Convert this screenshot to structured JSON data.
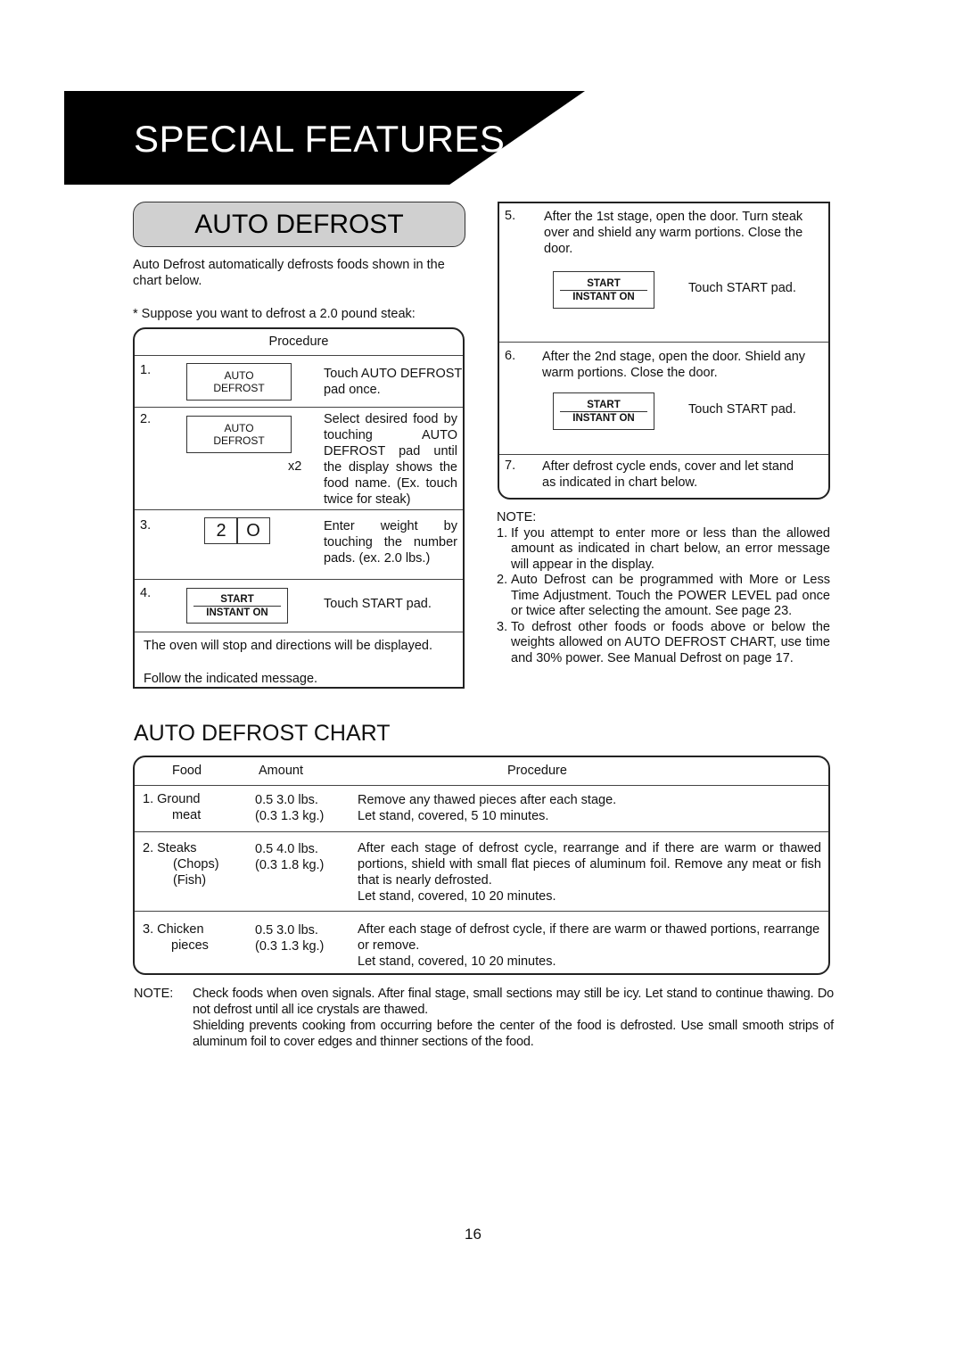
{
  "banner": {
    "title": "SPECIAL FEATURES"
  },
  "section": {
    "title": "AUTO DEFROST",
    "intro": "Auto Defrost automatically defrosts foods shown in the chart below.",
    "suppose": "*  Suppose you  want to defrost a 2.0 pound steak:"
  },
  "procedure": {
    "header": "Procedure",
    "steps": [
      {
        "num": "1.",
        "pad": [
          "AUTO",
          "DEFROST"
        ],
        "text": "Touch AUTO DEFROST pad once."
      },
      {
        "num": "2.",
        "pad": [
          "AUTO",
          "DEFROST"
        ],
        "multiplier": "x2",
        "text": "Select desired food by touching AUTO DEFROST pad until the display shows the food name. (Ex. touch twice for steak)"
      },
      {
        "num": "3.",
        "keys": [
          "2",
          "O"
        ],
        "text": "Enter weight by touching the number pads. (ex. 2.0 lbs.)"
      },
      {
        "num": "4.",
        "pad": [
          "START",
          "INSTANT ON"
        ],
        "text": "Touch START pad."
      }
    ],
    "footer": "The oven will stop and directions will be displayed.",
    "footer2": "Follow the indicated message.",
    "steps_right": [
      {
        "num": "5.",
        "text": "After the 1st stage, open the door. Turn steak over and shield any warm portions. Close the door.",
        "pad": [
          "START",
          "INSTANT ON"
        ],
        "action": "Touch START pad."
      },
      {
        "num": "6.",
        "text": "After the 2nd stage, open the door. Shield any warm portions. Close the door.",
        "pad": [
          "START",
          "INSTANT ON"
        ],
        "action": "Touch START pad."
      },
      {
        "num": "7.",
        "text": "After defrost cycle ends, cover and let stand as indicated in chart below."
      }
    ]
  },
  "notes": {
    "title": "NOTE:",
    "items": [
      {
        "num": "1.",
        "text": "If you attempt to enter more or less than the allowed amount as indicated in chart below, an  error message  will appear in the display."
      },
      {
        "num": "2.",
        "text": "Auto Defrost can be programmed with More or Less Time Adjustment. Touch the POWER LEVEL pad once or twice after selecting the amount. See page 23."
      },
      {
        "num": "3.",
        "text": "To defrost other foods or foods above or below the weights allowed on AUTO DEFROST CHART, use time and 30% power. See Manual Defrost on page 17."
      }
    ]
  },
  "chart": {
    "title": "AUTO DEFROST CHART",
    "headers": {
      "food": "Food",
      "amount": "Amount",
      "procedure": "Procedure"
    },
    "rows": [
      {
        "food": [
          "1. Ground",
          "meat"
        ],
        "amount": [
          "0.5  3.0 lbs.",
          "(0.3  1.3 kg.)"
        ],
        "procedure": [
          "Remove any thawed pieces after each stage.",
          "Let stand, covered, 5  10 minutes."
        ]
      },
      {
        "food": [
          "2. Steaks",
          "(Chops)",
          "(Fish)"
        ],
        "amount": [
          "0.5  4.0 lbs.",
          "(0.3  1.8 kg.)"
        ],
        "procedure": [
          "After each stage of defrost cycle, rearrange and if there are warm or thawed portions, shield with small flat pieces of aluminum foil. Remove any meat or fish that is nearly defrosted.",
          "Let stand, covered, 10  20 minutes."
        ]
      },
      {
        "food": [
          "3. Chicken",
          "pieces"
        ],
        "amount": [
          "0.5  3.0 lbs.",
          "(0.3  1.3 kg.)"
        ],
        "procedure": [
          "After each stage of defrost cycle, if there are warm or thawed portions, rearrange or remove.",
          "Let stand, covered, 10  20 minutes."
        ]
      }
    ]
  },
  "footnote": {
    "label": "NOTE:",
    "p1": "Check foods when oven signals. After final stage, small sections may still be icy. Let stand to continue thawing. Do not defrost until all ice crystals are thawed.",
    "p2": "Shielding prevents cooking from occurring before the center of the food is defrosted. Use small smooth strips of aluminum foil to cover edges and thinner sections of the food."
  },
  "page": {
    "number": "16"
  }
}
